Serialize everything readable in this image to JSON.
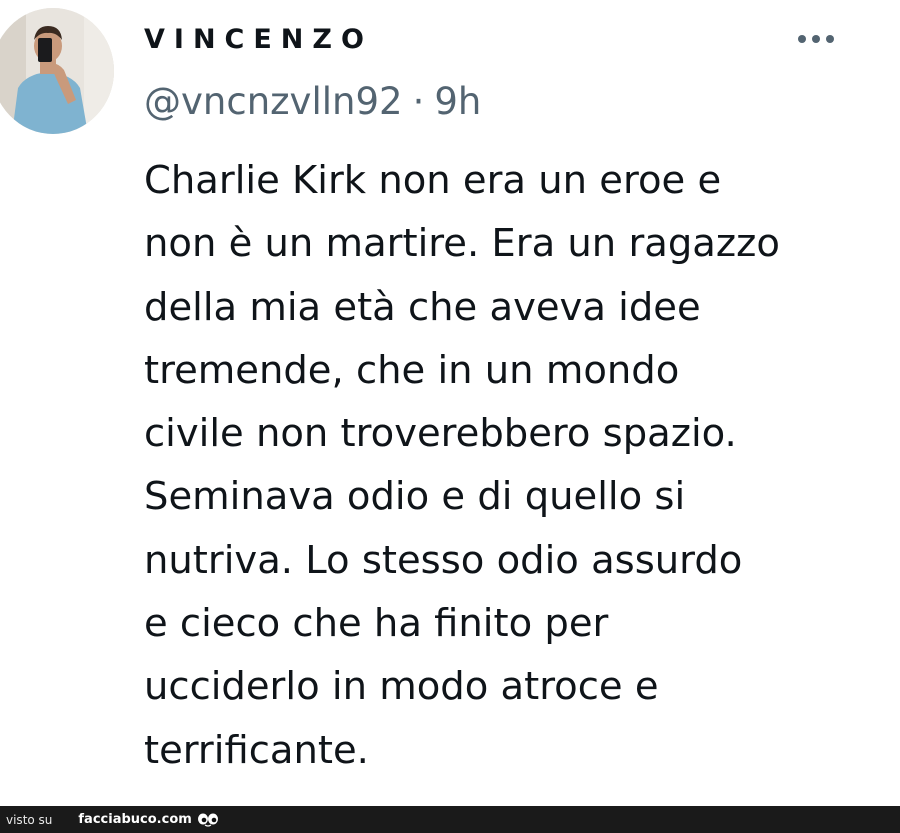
{
  "post": {
    "author": {
      "display_name": "VINCENZO",
      "handle": "@vncnzvlln92",
      "avatar_icon": "profile-avatar-photo"
    },
    "separator": "·",
    "time_ago": "9h",
    "more_icon": "more-options-icon",
    "text_lines": [
      "Charlie Kirk non era un eroe e",
      "non è un martire. Era un ragazzo",
      "della mia età che aveva idee",
      "tremende, che in un mondo",
      "civile non troverebbero spazio.",
      "Seminava odio e di quello si",
      "nutriva. Lo stesso odio assurdo",
      "e cieco che ha finito per",
      "ucciderlo in modo atroce e",
      "terrificante."
    ]
  },
  "watermark": {
    "prefix": "visto su",
    "site": "facciabuco.com",
    "logo_icon": "eyes-logo-icon"
  },
  "colors": {
    "text_primary": "#0f1419",
    "text_secondary": "#536471",
    "watermark_bg": "#1a1a1a"
  }
}
